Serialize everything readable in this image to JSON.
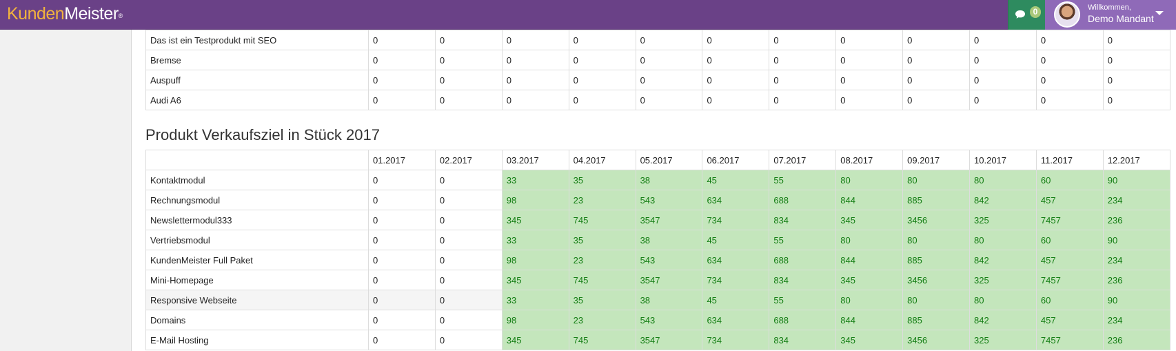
{
  "header": {
    "logo_part1": "Kunden",
    "logo_part2": "Meister",
    "logo_reg": "®",
    "chat_count": "0",
    "welcome": "Willkommen,",
    "user_name": "Demo Mandant"
  },
  "top_table": {
    "rows": [
      {
        "label": "Das ist ein Testprodukt mit SEO",
        "values": [
          "0",
          "0",
          "0",
          "0",
          "0",
          "0",
          "0",
          "0",
          "0",
          "0",
          "0",
          "0"
        ]
      },
      {
        "label": "Bremse",
        "values": [
          "0",
          "0",
          "0",
          "0",
          "0",
          "0",
          "0",
          "0",
          "0",
          "0",
          "0",
          "0"
        ]
      },
      {
        "label": "Auspuff",
        "values": [
          "0",
          "0",
          "0",
          "0",
          "0",
          "0",
          "0",
          "0",
          "0",
          "0",
          "0",
          "0"
        ]
      },
      {
        "label": "Audi A6",
        "values": [
          "0",
          "0",
          "0",
          "0",
          "0",
          "0",
          "0",
          "0",
          "0",
          "0",
          "0",
          "0"
        ]
      }
    ]
  },
  "section": {
    "title": "Produkt Verkaufsziel in Stück 2017"
  },
  "goal_table": {
    "months": [
      "01.2017",
      "02.2017",
      "03.2017",
      "04.2017",
      "05.2017",
      "06.2017",
      "07.2017",
      "08.2017",
      "09.2017",
      "10.2017",
      "11.2017",
      "12.2017"
    ],
    "rows": [
      {
        "label": "Kontaktmodul",
        "values": [
          "0",
          "0",
          "33",
          "35",
          "38",
          "45",
          "55",
          "80",
          "80",
          "80",
          "60",
          "90"
        ]
      },
      {
        "label": "Rechnungsmodul",
        "values": [
          "0",
          "0",
          "98",
          "23",
          "543",
          "634",
          "688",
          "844",
          "885",
          "842",
          "457",
          "234"
        ]
      },
      {
        "label": "Newslettermodul333",
        "values": [
          "0",
          "0",
          "345",
          "745",
          "3547",
          "734",
          "834",
          "345",
          "3456",
          "325",
          "7457",
          "236"
        ]
      },
      {
        "label": "Vertriebsmodul",
        "values": [
          "0",
          "0",
          "33",
          "35",
          "38",
          "45",
          "55",
          "80",
          "80",
          "80",
          "60",
          "90"
        ]
      },
      {
        "label": "KundenMeister Full Paket",
        "values": [
          "0",
          "0",
          "98",
          "23",
          "543",
          "634",
          "688",
          "844",
          "885",
          "842",
          "457",
          "234"
        ]
      },
      {
        "label": "Mini-Homepage",
        "values": [
          "0",
          "0",
          "345",
          "745",
          "3547",
          "734",
          "834",
          "345",
          "3456",
          "325",
          "7457",
          "236"
        ]
      },
      {
        "label": "Responsive Webseite",
        "values": [
          "0",
          "0",
          "33",
          "35",
          "38",
          "45",
          "55",
          "80",
          "80",
          "80",
          "60",
          "90"
        ]
      },
      {
        "label": "Domains",
        "values": [
          "0",
          "0",
          "98",
          "23",
          "543",
          "634",
          "688",
          "844",
          "885",
          "842",
          "457",
          "234"
        ]
      },
      {
        "label": "E-Mail Hosting",
        "values": [
          "0",
          "0",
          "345",
          "745",
          "3547",
          "734",
          "834",
          "345",
          "3456",
          "325",
          "7457",
          "236"
        ]
      }
    ]
  },
  "colors": {
    "topbar": "#6a4187",
    "logo_accent": "#f2b33d",
    "chat_button": "#2e8b5f",
    "user_area": "#8f6ab8",
    "goal_cell_bg": "#c4e6bc",
    "goal_cell_text": "#137d13"
  },
  "icons": {
    "chat": "chat-bubble-icon",
    "user_menu": "caret-down-icon"
  }
}
